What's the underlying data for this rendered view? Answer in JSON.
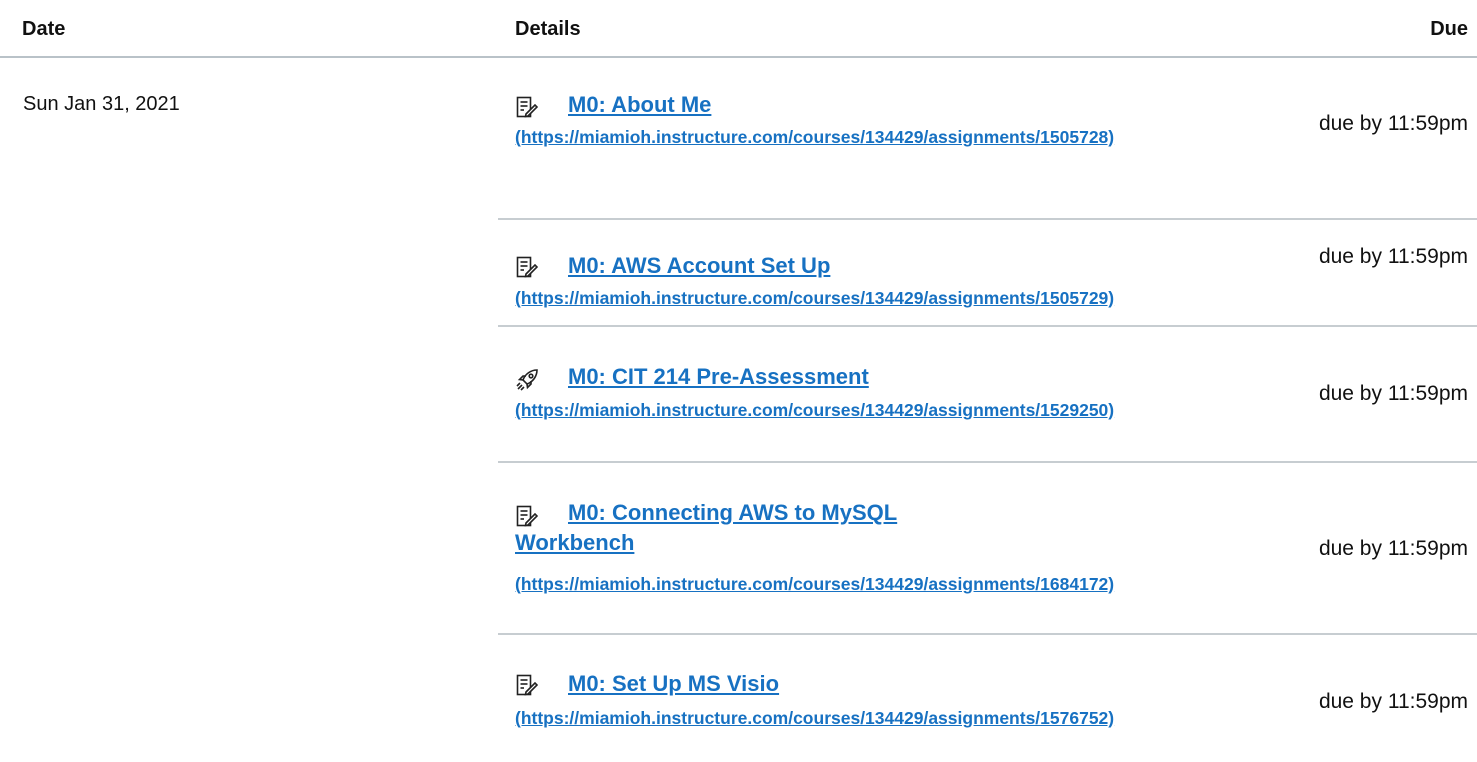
{
  "header": {
    "date": "Date",
    "details": "Details",
    "due": "Due"
  },
  "groups": [
    {
      "date": "Sun Jan 31, 2021",
      "items": [
        {
          "icon": "assignment-icon",
          "title": "M0: About Me",
          "url": "(https://miamioh.instructure.com/courses/134429/assignments/1505728)",
          "due": "due by 11:59pm"
        },
        {
          "icon": "assignment-icon",
          "title": "M0: AWS Account Set Up",
          "url": "(https://miamioh.instructure.com/courses/134429/assignments/1505729)",
          "due": "due by 11:59pm"
        },
        {
          "icon": "quiz-rocket-icon",
          "title": "M0: CIT 214 Pre-Assessment",
          "url": "(https://miamioh.instructure.com/courses/134429/assignments/1529250)",
          "due": "due by 11:59pm"
        },
        {
          "icon": "assignment-icon",
          "title": "M0: Connecting AWS to MySQL Workbench",
          "url": "(https://miamioh.instructure.com/courses/134429/assignments/1684172)",
          "due": "due by 11:59pm"
        },
        {
          "icon": "assignment-icon",
          "title": "M0: Set Up MS Visio",
          "url": "(https://miamioh.instructure.com/courses/134429/assignments/1576752)",
          "due": "due by 11:59pm"
        }
      ]
    }
  ]
}
